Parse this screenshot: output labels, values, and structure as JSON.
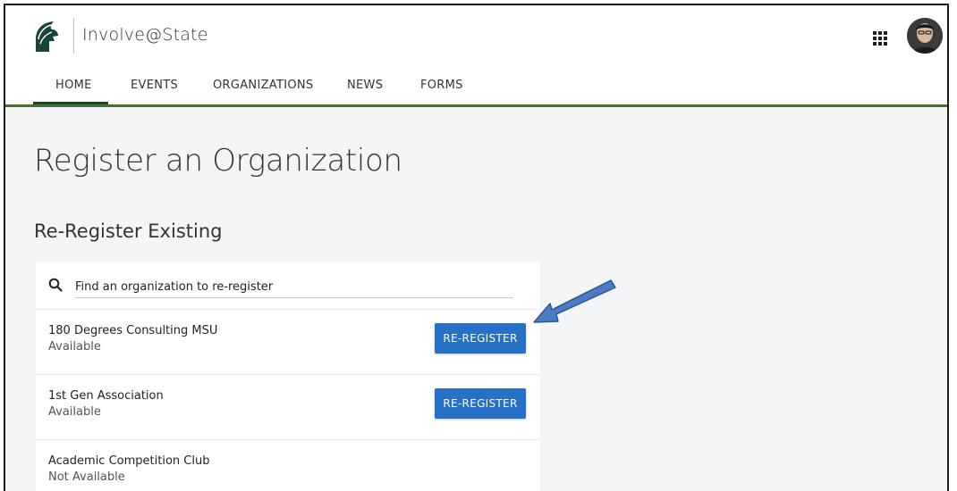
{
  "header": {
    "brand_name": "Involve@State"
  },
  "nav": {
    "tabs": [
      {
        "label": "HOME",
        "active": true
      },
      {
        "label": "EVENTS",
        "active": false
      },
      {
        "label": "ORGANIZATIONS",
        "active": false
      },
      {
        "label": "NEWS",
        "active": false
      },
      {
        "label": "FORMS",
        "active": false
      }
    ]
  },
  "main": {
    "page_title": "Register an Organization",
    "section_title": "Re-Register Existing",
    "search": {
      "placeholder": "Find an organization to re-register",
      "value": ""
    },
    "organizations": [
      {
        "name": "180 Degrees Consulting MSU",
        "status": "Available",
        "button_label": "RE-REGISTER"
      },
      {
        "name": "1st Gen Association",
        "status": "Available",
        "button_label": "RE-REGISTER"
      },
      {
        "name": "Academic Competition Club",
        "status": "Not Available"
      }
    ]
  },
  "colors": {
    "brand_green": "#18453b",
    "nav_underline": "#4c6e2e",
    "button_blue": "#2670c6",
    "annotation_arrow": "#4a7bc4",
    "page_background": "#f3f5f7"
  },
  "icons": [
    "spartan-logo-icon",
    "apps-grid-icon",
    "user-avatar",
    "search-icon",
    "annotation-arrow"
  ]
}
